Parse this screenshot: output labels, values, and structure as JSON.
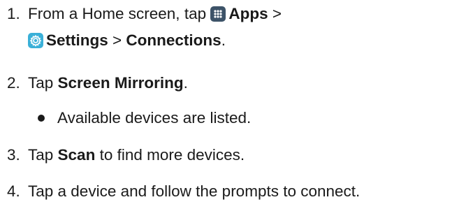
{
  "steps": [
    {
      "number": "1.",
      "line1": {
        "before": "From a Home screen, tap ",
        "apps_label": "Apps",
        "sep1": " >"
      },
      "line2": {
        "settings_label": "Settings",
        "sep2": " > ",
        "connections_label": "Connections",
        "end": "."
      }
    },
    {
      "number": "2.",
      "before": "Tap ",
      "bold": "Screen Mirroring",
      "end": "."
    },
    {
      "bullet": "Available devices are listed."
    },
    {
      "number": "3.",
      "before": "Tap ",
      "bold": "Scan",
      "end": " to find more devices."
    },
    {
      "number": "4.",
      "text": "Tap a device and follow the prompts to connect."
    }
  ],
  "icons": {
    "apps": "apps-grid-icon",
    "settings": "settings-gear-icon"
  },
  "colors": {
    "apps_icon_bg": "#3d5368",
    "settings_icon_bg": "#3ab0d8",
    "text": "#1a1a1a"
  }
}
